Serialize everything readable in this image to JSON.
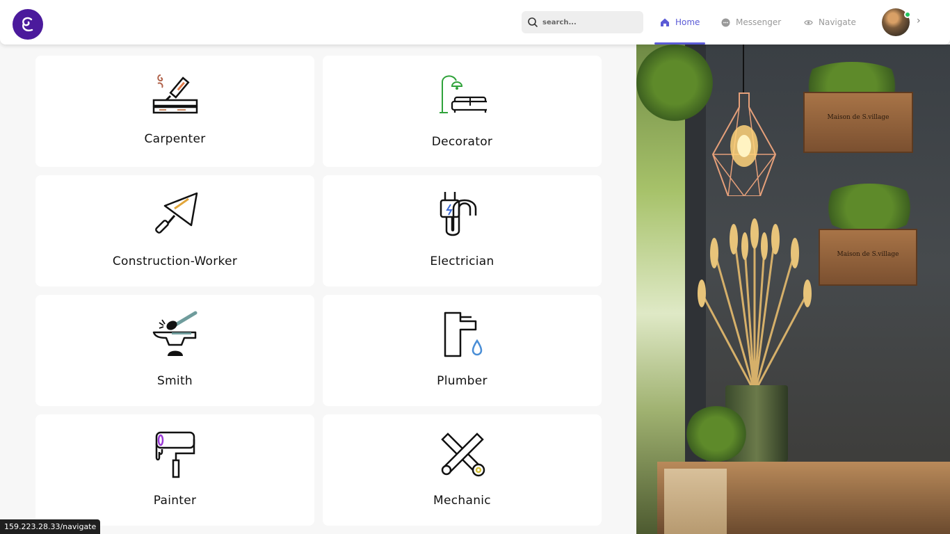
{
  "search": {
    "placeholder": "search..."
  },
  "nav": [
    {
      "label": "Home",
      "active": true
    },
    {
      "label": "Messenger",
      "active": false
    },
    {
      "label": "Navigate",
      "active": false
    }
  ],
  "colors": {
    "accent": "#5b5bd6",
    "logo": "#4b1a9c",
    "online": "#22c55e"
  },
  "cards": [
    {
      "label": "Carpenter",
      "icon": "carpenter-icon"
    },
    {
      "label": "Decorator",
      "icon": "decorator-icon"
    },
    {
      "label": "Construction-Worker",
      "icon": "trowel-icon"
    },
    {
      "label": "Electrician",
      "icon": "plug-icon"
    },
    {
      "label": "Smith",
      "icon": "anvil-icon"
    },
    {
      "label": "Plumber",
      "icon": "faucet-icon"
    },
    {
      "label": "Painter",
      "icon": "paint-roller-icon"
    },
    {
      "label": "Mechanic",
      "icon": "wrench-icon"
    }
  ],
  "photo": {
    "crate_text": [
      "Maison de S.village",
      "Maison de S.village"
    ]
  },
  "status_url": "159.223.28.33/navigate"
}
